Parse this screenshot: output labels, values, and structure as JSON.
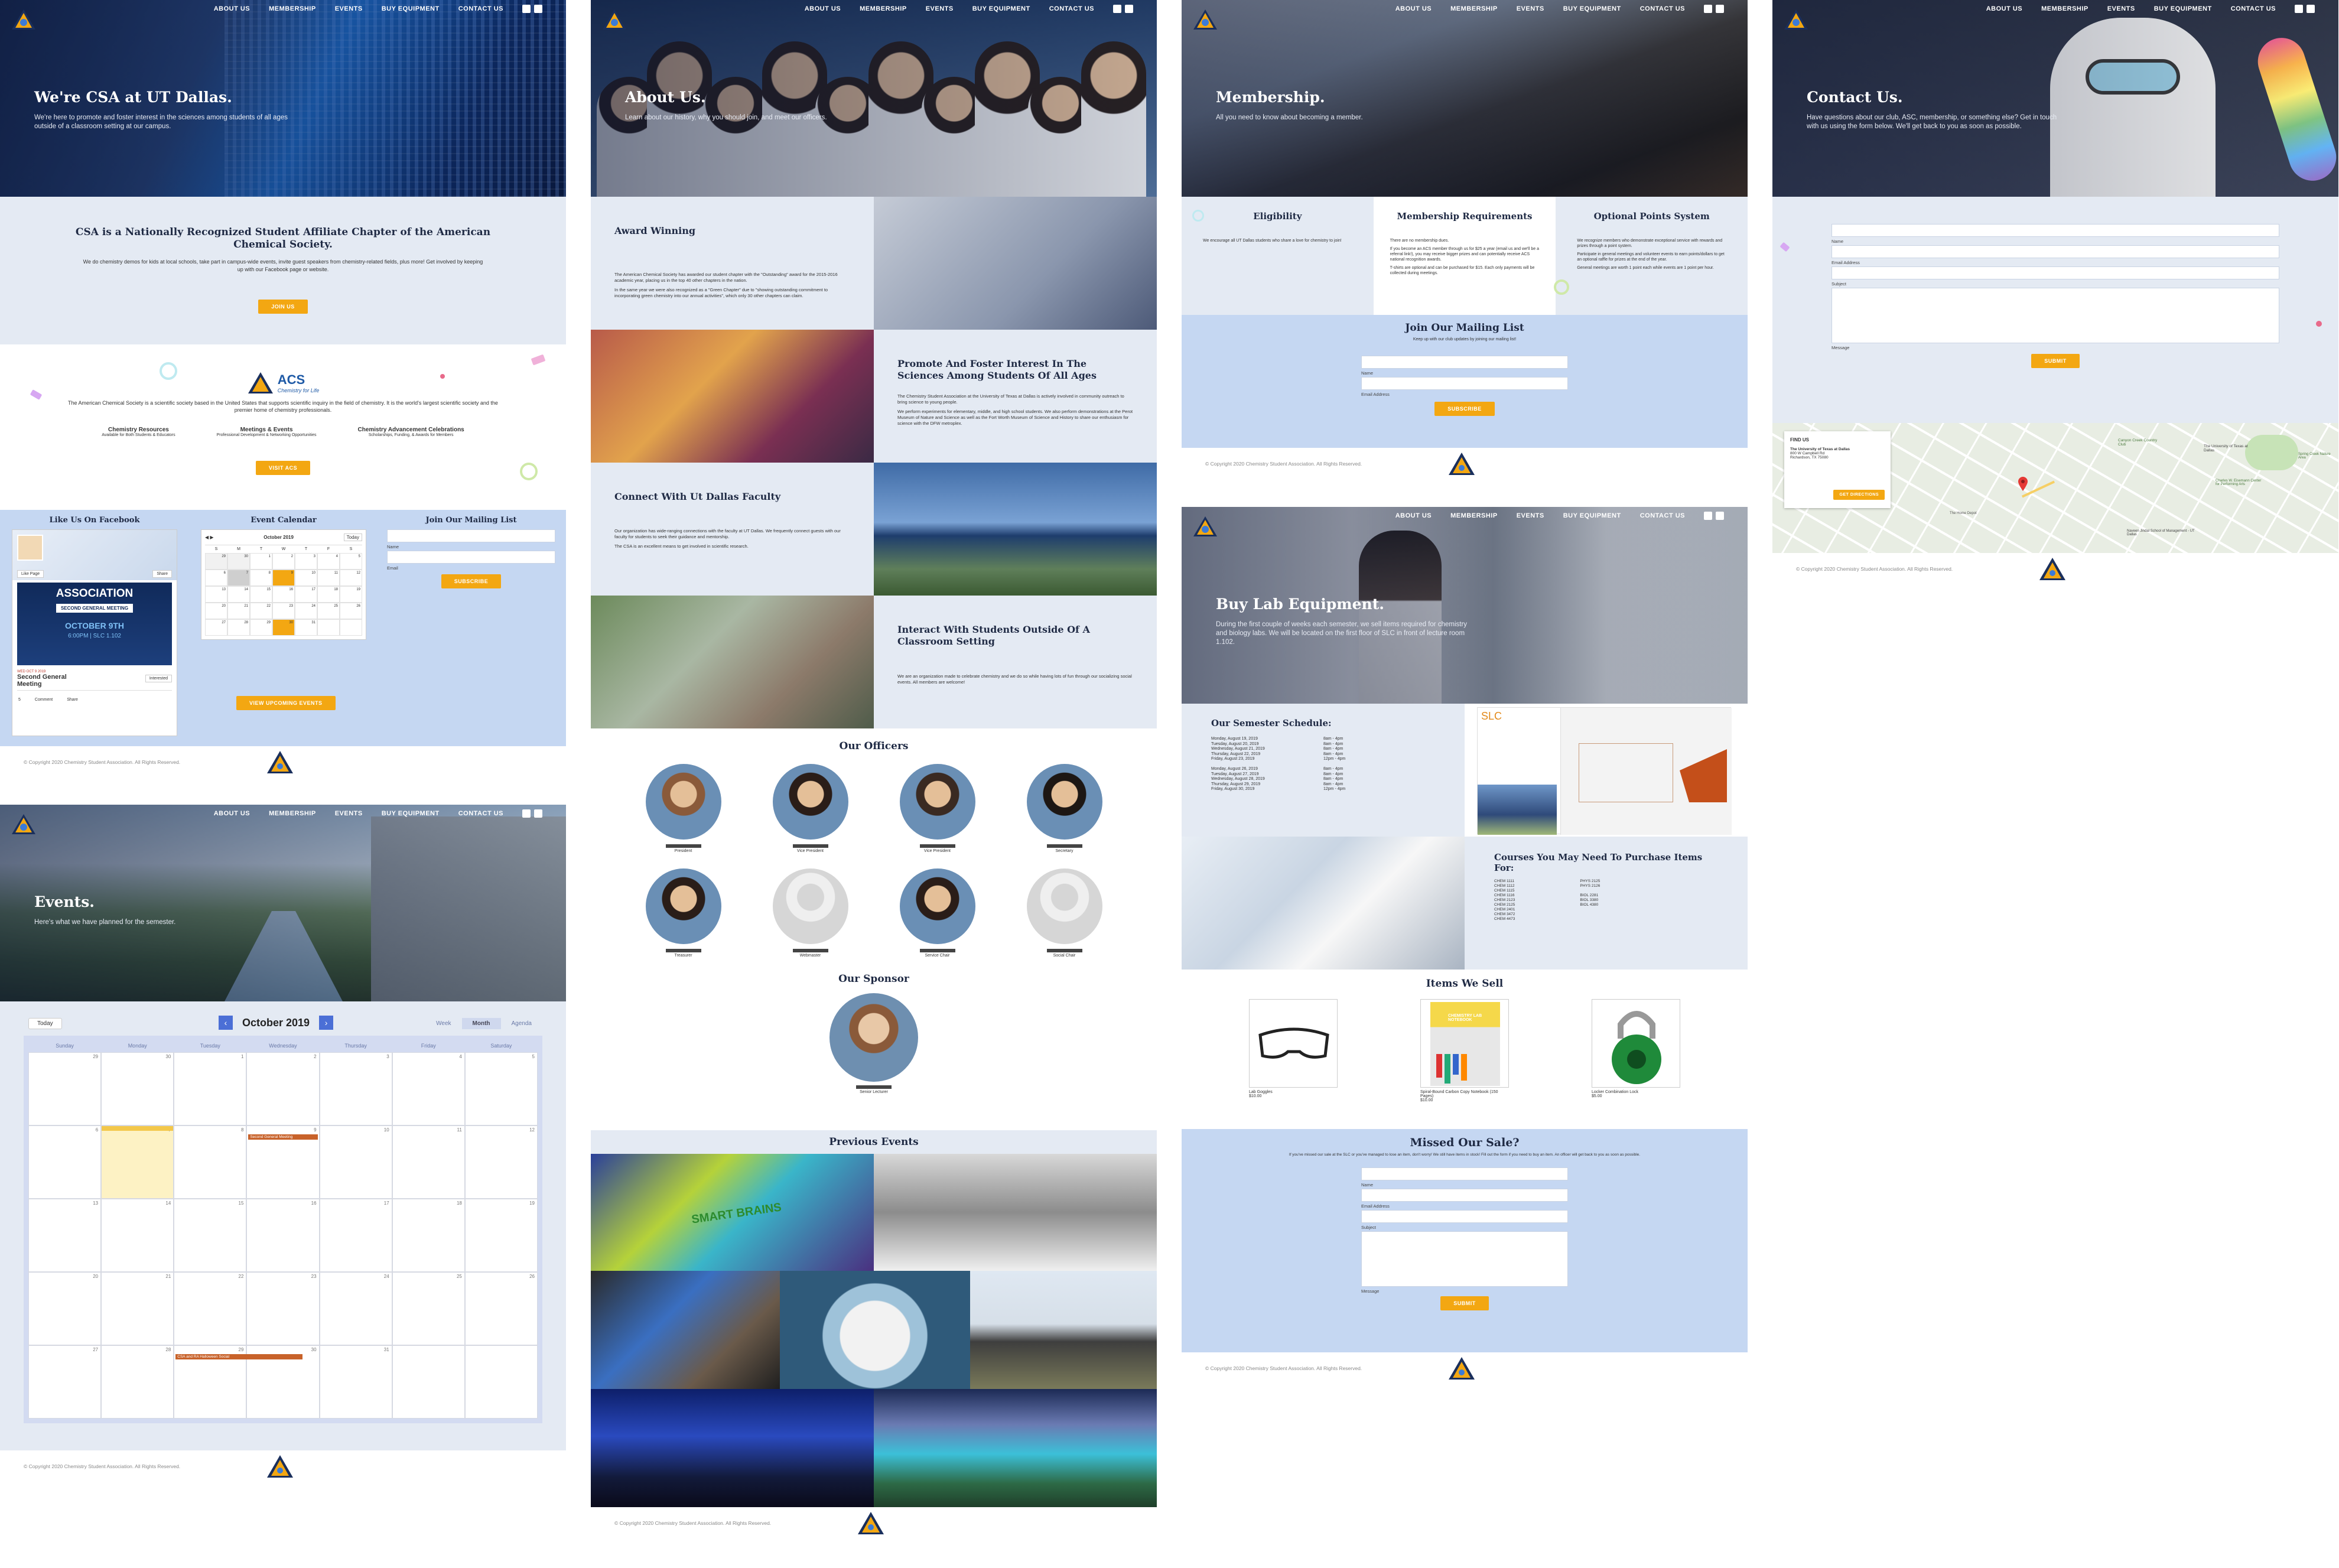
{
  "nav": {
    "about": "ABOUT US",
    "membership": "MEMBERSHIP",
    "events": "EVENTS",
    "buy": "BUY EQUIPMENT",
    "contact": "CONTACT US"
  },
  "footer": {
    "copyright": "© Copyright 2020 Chemistry Student Association. All Rights Reserved."
  },
  "colors": {
    "accent": "#f3a712",
    "light_blue": "#e4eaf3",
    "mid_blue": "#c5d7f2",
    "navy": "#1a2f5c"
  },
  "home": {
    "hero_title": "We're CSA at UT Dallas.",
    "hero_text": "We're here to promote and foster interest in the sciences among students of all ages outside of a classroom setting at our campus.",
    "intro_title": "CSA is a Nationally Recognized Student Affiliate Chapter of the American Chemical Society.",
    "intro_text": "We do chemistry demos for kids at local schools, take part in campus-wide events, invite guest speakers from chemistry-related fields, plus more! Get involved by keeping up with our Facebook page or website.",
    "join_button": "JOIN US",
    "acs_logo_text": "ACS",
    "acs_tagline": "Chemistry for Life",
    "acs_text": "The American Chemical Society is a scientific society based in the United States that supports scientific inquiry in the field of chemistry. It is the world's largest scientific society and the premier home of chemistry professionals.",
    "features": [
      {
        "title": "Chemistry Resources",
        "sub": "Available for Both Students & Educators"
      },
      {
        "title": "Meetings & Events",
        "sub": "Professional Development & Networking Opportunities"
      },
      {
        "title": "Chemistry Advancement Celebrations",
        "sub": "Scholarships, Funding, & Awards for Members"
      }
    ],
    "visit_button": "VISIT ACS",
    "fb_title": "Like Us On Facebook",
    "fb_like": "Like Page",
    "fb_share": "Share",
    "fb_banner": "ASSOCIATION",
    "fb_meeting_tag": "SECOND GENERAL MEETING",
    "fb_date": "OCTOBER 9TH",
    "fb_time": "6:00PM | SLC 1.102",
    "fb_event_date": "WED OCT 9 2019",
    "fb_event_title": "Second General Meeting",
    "fb_interested": "Interested",
    "fb_comment": "Comment",
    "fb_share2": "Share",
    "fb_likes": "5",
    "cal_title": "Event Calendar",
    "cal_month": "October 2019",
    "cal_today": "Today",
    "cal_days": [
      "S",
      "M",
      "T",
      "W",
      "T",
      "F",
      "S"
    ],
    "mail_title": "Join Our Mailing List",
    "mail_name": "Name",
    "mail_email": "Email",
    "subscribe": "SUBSCRIBE",
    "upcoming_button": "VIEW UPCOMING EVENTS"
  },
  "events": {
    "hero_title": "Events.",
    "hero_text": "Here's what we have planned for the semester.",
    "today": "Today",
    "month": "October 2019",
    "views": [
      "Week",
      "Month",
      "Agenda"
    ],
    "weekdays": [
      "Sunday",
      "Monday",
      "Tuesday",
      "Wednesday",
      "Thursday",
      "Friday",
      "Saturday"
    ],
    "weeks": [
      [
        "29",
        "30",
        "1",
        "2",
        "3",
        "4",
        "5"
      ],
      [
        "6",
        "7",
        "8",
        "9",
        "10",
        "11",
        "12"
      ],
      [
        "13",
        "14",
        "15",
        "16",
        "17",
        "18",
        "19"
      ],
      [
        "20",
        "21",
        "22",
        "23",
        "24",
        "25",
        "26"
      ],
      [
        "27",
        "28",
        "29",
        "30",
        "31",
        "",
        ""
      ]
    ],
    "event1": "Second General Meeting",
    "event2": "CSA and RA Halloween Social"
  },
  "about": {
    "hero_title": "About Us.",
    "hero_text": "Learn about our history, why you should join, and meet our officers.",
    "sections": [
      {
        "title": "Award Winning",
        "text": "The American Chemical Society has awarded our student chapter with the \"Outstanding\" award for the 2015-2016 academic year, placing us in the top 40 other chapters in the nation.",
        "text2": "In the same year we were also recognized as a \"Green Chapter\" due to \"showing outstanding commitment to incorporating green chemistry into our annual activities\", which only 30 other chapters can claim."
      },
      {
        "title": "Promote And Foster Interest In The Sciences Among Students Of All Ages",
        "text": "The Chemistry Student Association at the University of Texas at Dallas is actively involved in community outreach to bring science to young people.",
        "text2": "We perform experiments for elementary, middle, and high school students. We also perform demonstrations at the Perot Museum of Nature and Science as well as the Fort Worth Museum of Science and History to share our enthusiasm for science with the DFW metroplex."
      },
      {
        "title": "Connect With Ut Dallas Faculty",
        "text": "Our organization has wide-ranging connections with the faculty at UT Dallas. We frequently connect guests with our faculty for students to seek their guidance and mentorship.",
        "text2": "The CSA is an excellent means to get involved in scientific research."
      },
      {
        "title": "Interact With Students Outside Of A Classroom Setting",
        "text": "We are an organization made to celebrate chemistry and we do so while having lots of fun through our socializing social events. All members are welcome!",
        "text2": ""
      }
    ],
    "officers_title": "Our Officers",
    "officers": [
      "President",
      "Vice President",
      "Vice President",
      "Secretary",
      "Treasurer",
      "Webmaster",
      "Service Chair",
      "Social Chair"
    ],
    "sponsor_title": "Our Sponsor",
    "sponsor_role": "Senior Lecturer",
    "previous_title": "Previous Events",
    "banner_text": "SMART BRAINS"
  },
  "membership": {
    "hero_title": "Membership.",
    "hero_text": "All you need to know about becoming a member.",
    "cols": [
      {
        "title": "Eligibility",
        "text": "We encourage all UT Dallas students who share a love for chemistry to join!"
      },
      {
        "title": "Membership Requirements",
        "text": "There are no membership dues.",
        "text2": "If you become an ACS member through us for $25 a year (email us and we'll be a referral link!), you may receive bigger prizes and can potentially receive ACS national recognition awards.",
        "text3": "T-shirts are optional and can be purchased for $15. Each only payments will be collected during meetings."
      },
      {
        "title": "Optional Points System",
        "text": "We recognize members who demonstrate exceptional service with rewards and prizes through a point system.",
        "text2": "Participate in general meetings and volunteer events to earn points/dollars to get an optional raffle for prizes at the end of the year.",
        "text3": "General meetings are worth 1 point each while events are 1 point per hour."
      }
    ],
    "mail_title": "Join Our Mailing List",
    "mail_sub": "Keep up with our club updates by joining our mailing list!",
    "name": "Name",
    "email": "Email Address",
    "subscribe": "SUBSCRIBE"
  },
  "buy": {
    "hero_title": "Buy Lab Equipment.",
    "hero_text": "During the first couple of weeks each semester, we sell items required for chemistry and biology labs. We will be located on the first floor of SLC in front of lecture room 1.102.",
    "schedule_title": "Our Semester Schedule:",
    "schedule": [
      [
        "Monday, August 19, 2019",
        "8am - 4pm"
      ],
      [
        "Tuesday, August 20, 2019",
        "8am - 4pm"
      ],
      [
        "Wednesday, August 21, 2019",
        "8am - 4pm"
      ],
      [
        "Thursday, August 22, 2019",
        "8am - 4pm"
      ],
      [
        "Friday, August 23, 2019",
        "12pm - 4pm"
      ],
      [
        "",
        ""
      ],
      [
        "Monday, August 26, 2019",
        "8am - 4pm"
      ],
      [
        "Tuesday, August 27, 2019",
        "8am - 4pm"
      ],
      [
        "Wednesday, August 28, 2019",
        "8am - 4pm"
      ],
      [
        "Thursday, August 29, 2019",
        "8am - 4pm"
      ],
      [
        "Friday, August 30, 2019",
        "12pm - 4pm"
      ]
    ],
    "map_title": "SLC",
    "courses_title": "Courses You May Need To Purchase Items For:",
    "courses_a": [
      "CHEM 1111",
      "CHEM 1112",
      "CHEM 1115",
      "CHEM 1116",
      "CHEM 2123",
      "CHEM 2125",
      "CHEM 2401",
      "CHEM 3472",
      "CHEM 4473"
    ],
    "courses_b": [
      "PHYS 2125",
      "PHYS 2126",
      "",
      "BIOL 2281",
      "BIOL 3380",
      "BIOL 4380",
      ""
    ],
    "items_title": "Items We Sell",
    "items": [
      {
        "name": "Lab Goggles",
        "price": "$10.00"
      },
      {
        "name": "Spiral-Bound Carbon Copy Notebook (150 Pages)",
        "price": "$10.00"
      },
      {
        "name": "Locker Combination Lock",
        "price": "$5.00"
      }
    ],
    "missed_title": "Missed Our Sale?",
    "missed_text": "If you've missed our sale at the SLC or you've managed to lose an item, don't worry! We still have items in stock! Fill out the form if you need to buy an item. An officer will get back to you as soon as possible.",
    "name": "Name",
    "email": "Email Address",
    "subject": "Subject",
    "message": "Message",
    "submit": "SUBMIT",
    "notebook_label": "CHEMISTRY LAB NOTEBOOK"
  },
  "contact": {
    "hero_title": "Contact Us.",
    "hero_text": "Have questions about our club, ASC, membership, or something else? Get in touch with us using the form below. We'll get back to you as soon as possible.",
    "name": "Name",
    "email": "Email Address",
    "subject": "Subject",
    "message": "Message",
    "submit": "SUBMIT",
    "find_title": "FIND US",
    "address_name": "The University of Texas at Dallas",
    "address_line1": "800 W Campbell Rd",
    "address_line2": "Richardson, TX 75080",
    "directions": "GET DIRECTIONS",
    "map_labels": [
      "Canyon Creek Country Club",
      "The University of Texas at Dallas",
      "Naveen Jindal School of Management - UT Dallas",
      "Spring Creek Nature Area",
      "The Home Depot",
      "Charles W. Eisemann Center for Performing Arts"
    ]
  }
}
